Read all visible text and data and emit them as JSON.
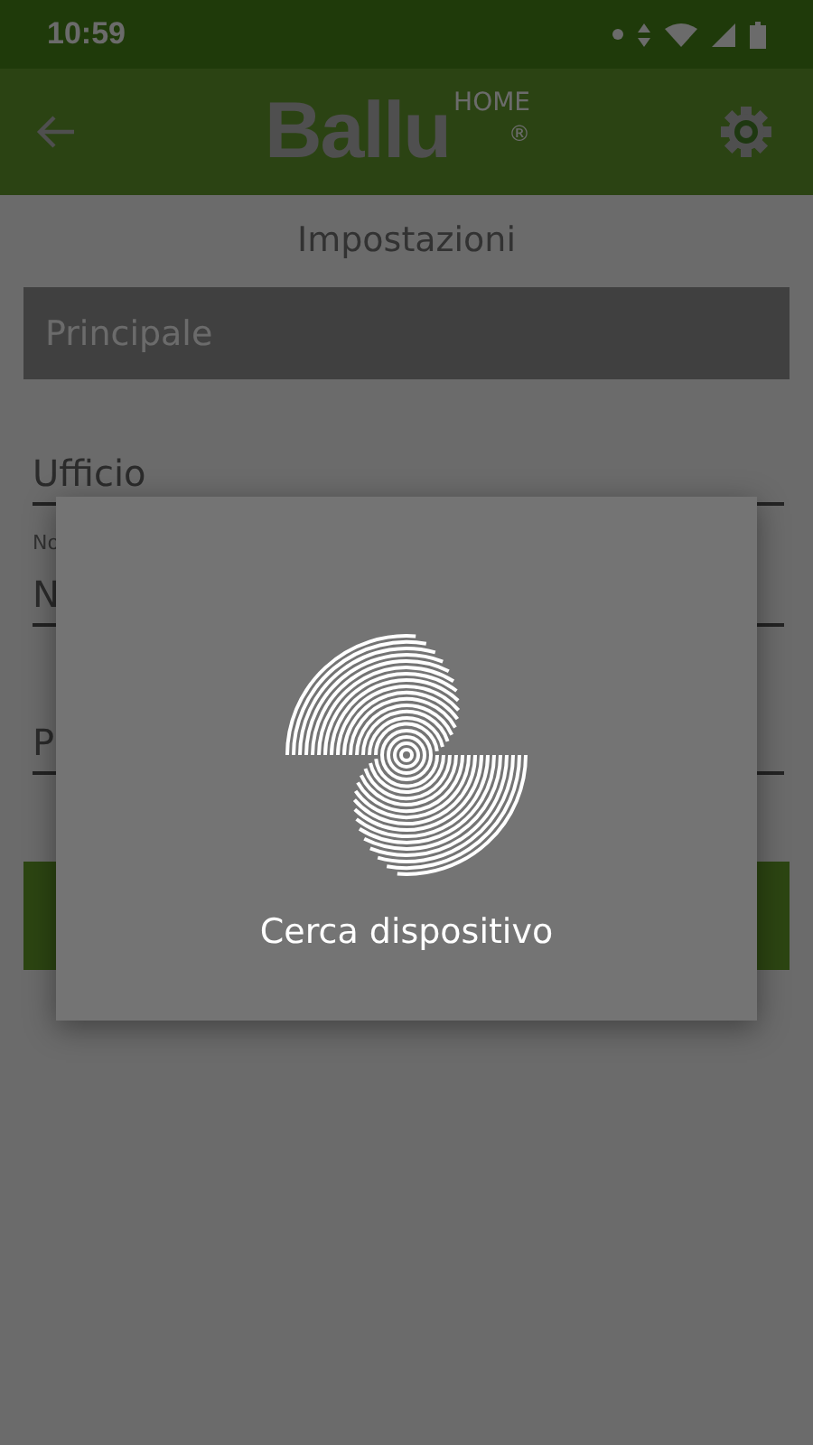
{
  "status_bar": {
    "time": "10:59"
  },
  "app_bar": {
    "logo": {
      "name": "Ballu",
      "superscript": "HOME",
      "mark": "®"
    }
  },
  "title": "Impostazioni",
  "selector": {
    "value": "Principale"
  },
  "fields": [
    {
      "value": "Ufficio"
    },
    {
      "label": "No",
      "value": "N"
    },
    {
      "value": "P"
    }
  ],
  "dialog": {
    "message": "Cerca dispositivo"
  }
}
